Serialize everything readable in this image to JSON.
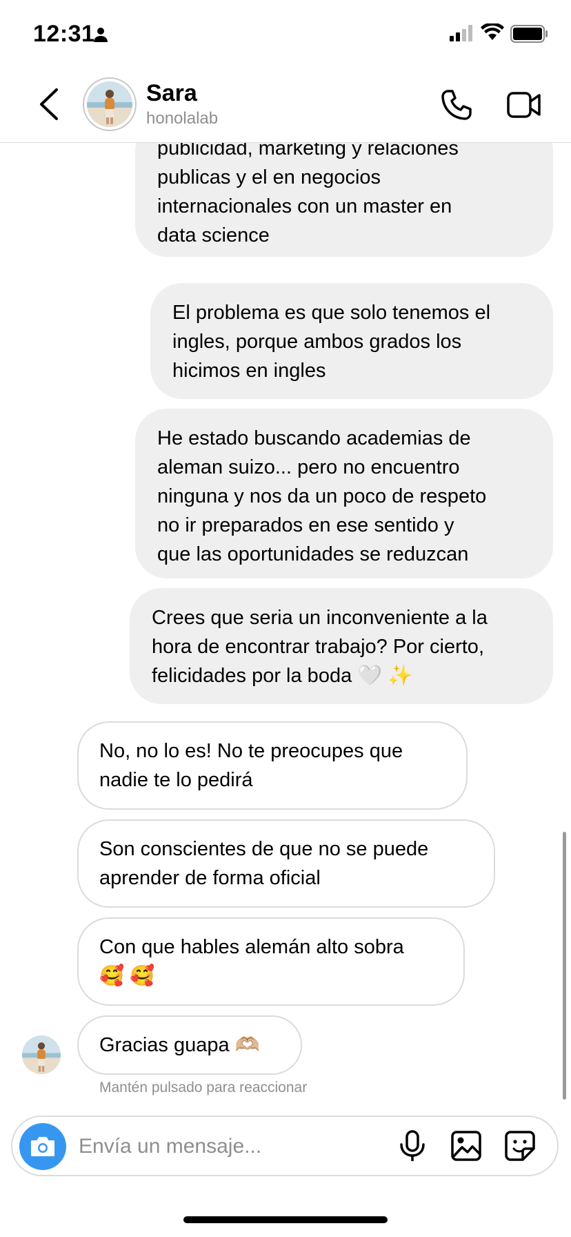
{
  "status_bar": {
    "time": "12:31"
  },
  "header": {
    "back_icon": "chevron-left-icon",
    "name": "Sara",
    "username": "honolalab",
    "actions": [
      "phone-icon",
      "video-camera-icon"
    ]
  },
  "messages": [
    {
      "direction": "outgoing",
      "text": "publicidad, marketing y relaciones\npublicas y el en negocios\ninternacionales con un master en\ndata science"
    },
    {
      "direction": "outgoing",
      "text": "El problema es que solo tenemos el\ningles, porque ambos grados los\nhicimos en ingles"
    },
    {
      "direction": "outgoing",
      "text": "He estado buscando academias de\naleman suizo... pero no encuentro\nninguna y nos da un poco de respeto\nno ir preparados en ese sentido y\nque las oportunidades se reduzcan"
    },
    {
      "direction": "outgoing",
      "text": "Crees que seria un inconveniente a la\nhora de encontrar trabajo? Por cierto,\nfelicidades por la boda 🤍 ✨"
    },
    {
      "direction": "incoming",
      "text": "No, no lo es! No te preocupes que\nnadie te lo pedirá"
    },
    {
      "direction": "incoming",
      "text": "Son conscientes de que no se puede\naprender de forma oficial"
    },
    {
      "direction": "incoming",
      "text": "Con que hables alemán alto sobra\n🥰 🥰"
    },
    {
      "direction": "incoming",
      "text": "Gracias guapa 🫶🏼"
    }
  ],
  "reaction_hint": "Mantén pulsado para reaccionar",
  "composer": {
    "placeholder": "Envía un mensaje...",
    "icons": [
      "camera-icon",
      "microphone-icon",
      "image-icon",
      "sticker-icon"
    ]
  },
  "colors": {
    "accent": "#3797f0",
    "outgoing_bubble": "#efefef",
    "border": "#dbdbdb",
    "muted_text": "#8e8e8e"
  }
}
